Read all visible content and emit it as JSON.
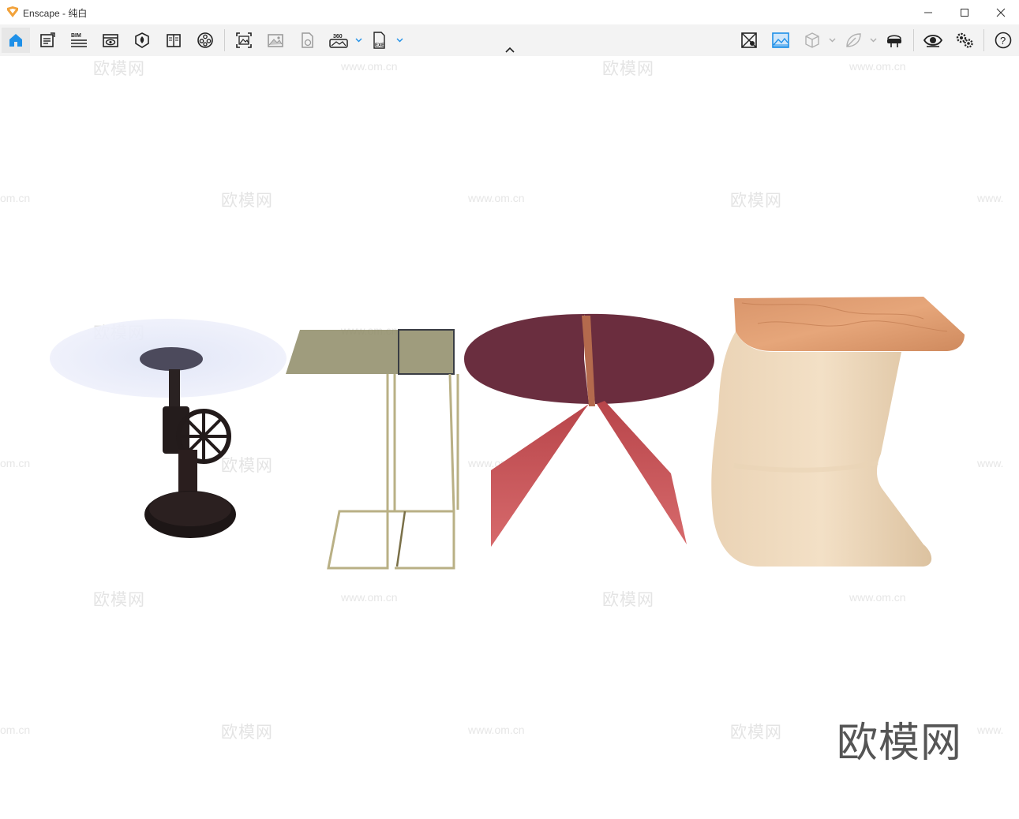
{
  "window": {
    "app_name": "Enscape",
    "separator": " - ",
    "document_name": "纯白",
    "minimize_icon": "minimize-icon",
    "maximize_icon": "maximize-icon",
    "close_icon": "close-icon"
  },
  "toolbar": {
    "left_tools": [
      {
        "icon": "home-icon",
        "active": true
      },
      {
        "icon": "project-notes-icon"
      },
      {
        "icon": "bim-icon",
        "label": "BIM"
      },
      {
        "icon": "view-management-icon"
      },
      {
        "icon": "asset-library-icon"
      },
      {
        "icon": "material-editor-icon"
      },
      {
        "icon": "atmosphere-settings-icon"
      },
      {
        "icon": "screenshot-icon"
      },
      {
        "icon": "batch-render-icon"
      },
      {
        "icon": "web-standalone-icon"
      },
      {
        "icon": "panorama-360-icon",
        "label": "360"
      },
      {
        "icon": "exe-export-icon",
        "label": "EXE"
      }
    ],
    "right_tools": [
      {
        "icon": "orthographic-view-icon"
      },
      {
        "icon": "capture-view-icon"
      },
      {
        "icon": "box-icon"
      },
      {
        "icon": "leaf-icon"
      },
      {
        "icon": "vr-headset-icon"
      },
      {
        "icon": "eye-icon"
      },
      {
        "icon": "settings-gears-icon"
      },
      {
        "icon": "help-icon",
        "label": "?"
      }
    ],
    "accent_color": "#1e90e8",
    "collapse_icon": "chevron-up-icon"
  },
  "watermarks": {
    "brand": "欧模网",
    "url": "www.om.cn",
    "url_partial_left": "om.cn",
    "url_partial_right": "www.",
    "big_brand": "欧模网"
  },
  "scene": {
    "objects": [
      "industrial-crank-side-table",
      "glass-c-side-table",
      "butterfly-red-side-table",
      "wood-top-cantilever-side-table"
    ]
  }
}
